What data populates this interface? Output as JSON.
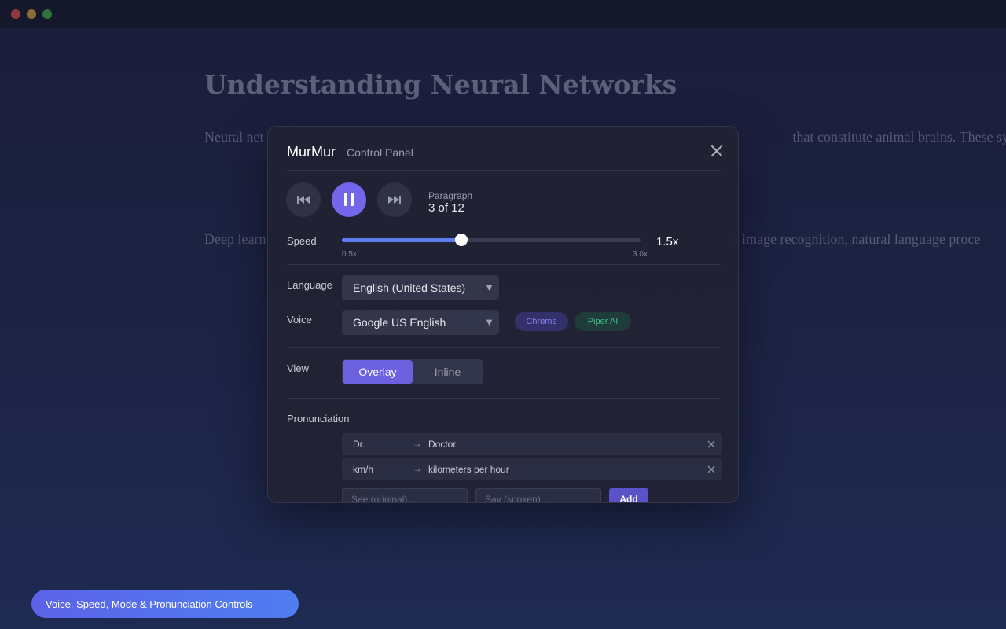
{
  "window": {},
  "article": {
    "title": "Understanding Neural Networks",
    "p1_start": "Neural net",
    "p1_end": "that constitute animal brains. These systems",
    "p2_start": "Deep learn",
    "p2_end": "n image recognition, natural language proce"
  },
  "panel": {
    "brand": "MurMur",
    "subtitle": "Control Panel",
    "close_icon": "close-icon"
  },
  "playback": {
    "prev_icon": "skip-previous-icon",
    "play_state": "playing",
    "pause_icon": "pause-icon",
    "next_icon": "skip-next-icon",
    "paragraph_label": "Paragraph",
    "paragraph_value": "3 of 12"
  },
  "speed": {
    "label": "Speed",
    "min_label": "0.5x",
    "max_label": "3.0x",
    "value_label": "1.5x",
    "value": 1.5,
    "min": 0.5,
    "max": 3.0,
    "accent": "#5b7cf0"
  },
  "language": {
    "label": "Language",
    "selected": "English (United States)"
  },
  "voice": {
    "label": "Voice",
    "selected": "Google US English",
    "chips": [
      {
        "label": "Chrome",
        "color": "#8b82f3"
      },
      {
        "label": "Piper AI",
        "color": "#3fc08c"
      }
    ]
  },
  "view": {
    "label": "View",
    "options": [
      "Overlay",
      "Inline"
    ],
    "active": "Overlay",
    "accent": "#6c62e0"
  },
  "pronunciation": {
    "label": "Pronunciation",
    "arrow": "→",
    "rows": [
      {
        "original": "Dr.",
        "spoken": "Doctor"
      },
      {
        "original": "km/h",
        "spoken": "kilometers per hour"
      }
    ],
    "original_placeholder": "See (original)...",
    "spoken_placeholder": "Say (spoken)...",
    "add_label": "Add"
  },
  "caption": {
    "text": "Voice, Speed, Mode & Pronunciation Controls"
  }
}
